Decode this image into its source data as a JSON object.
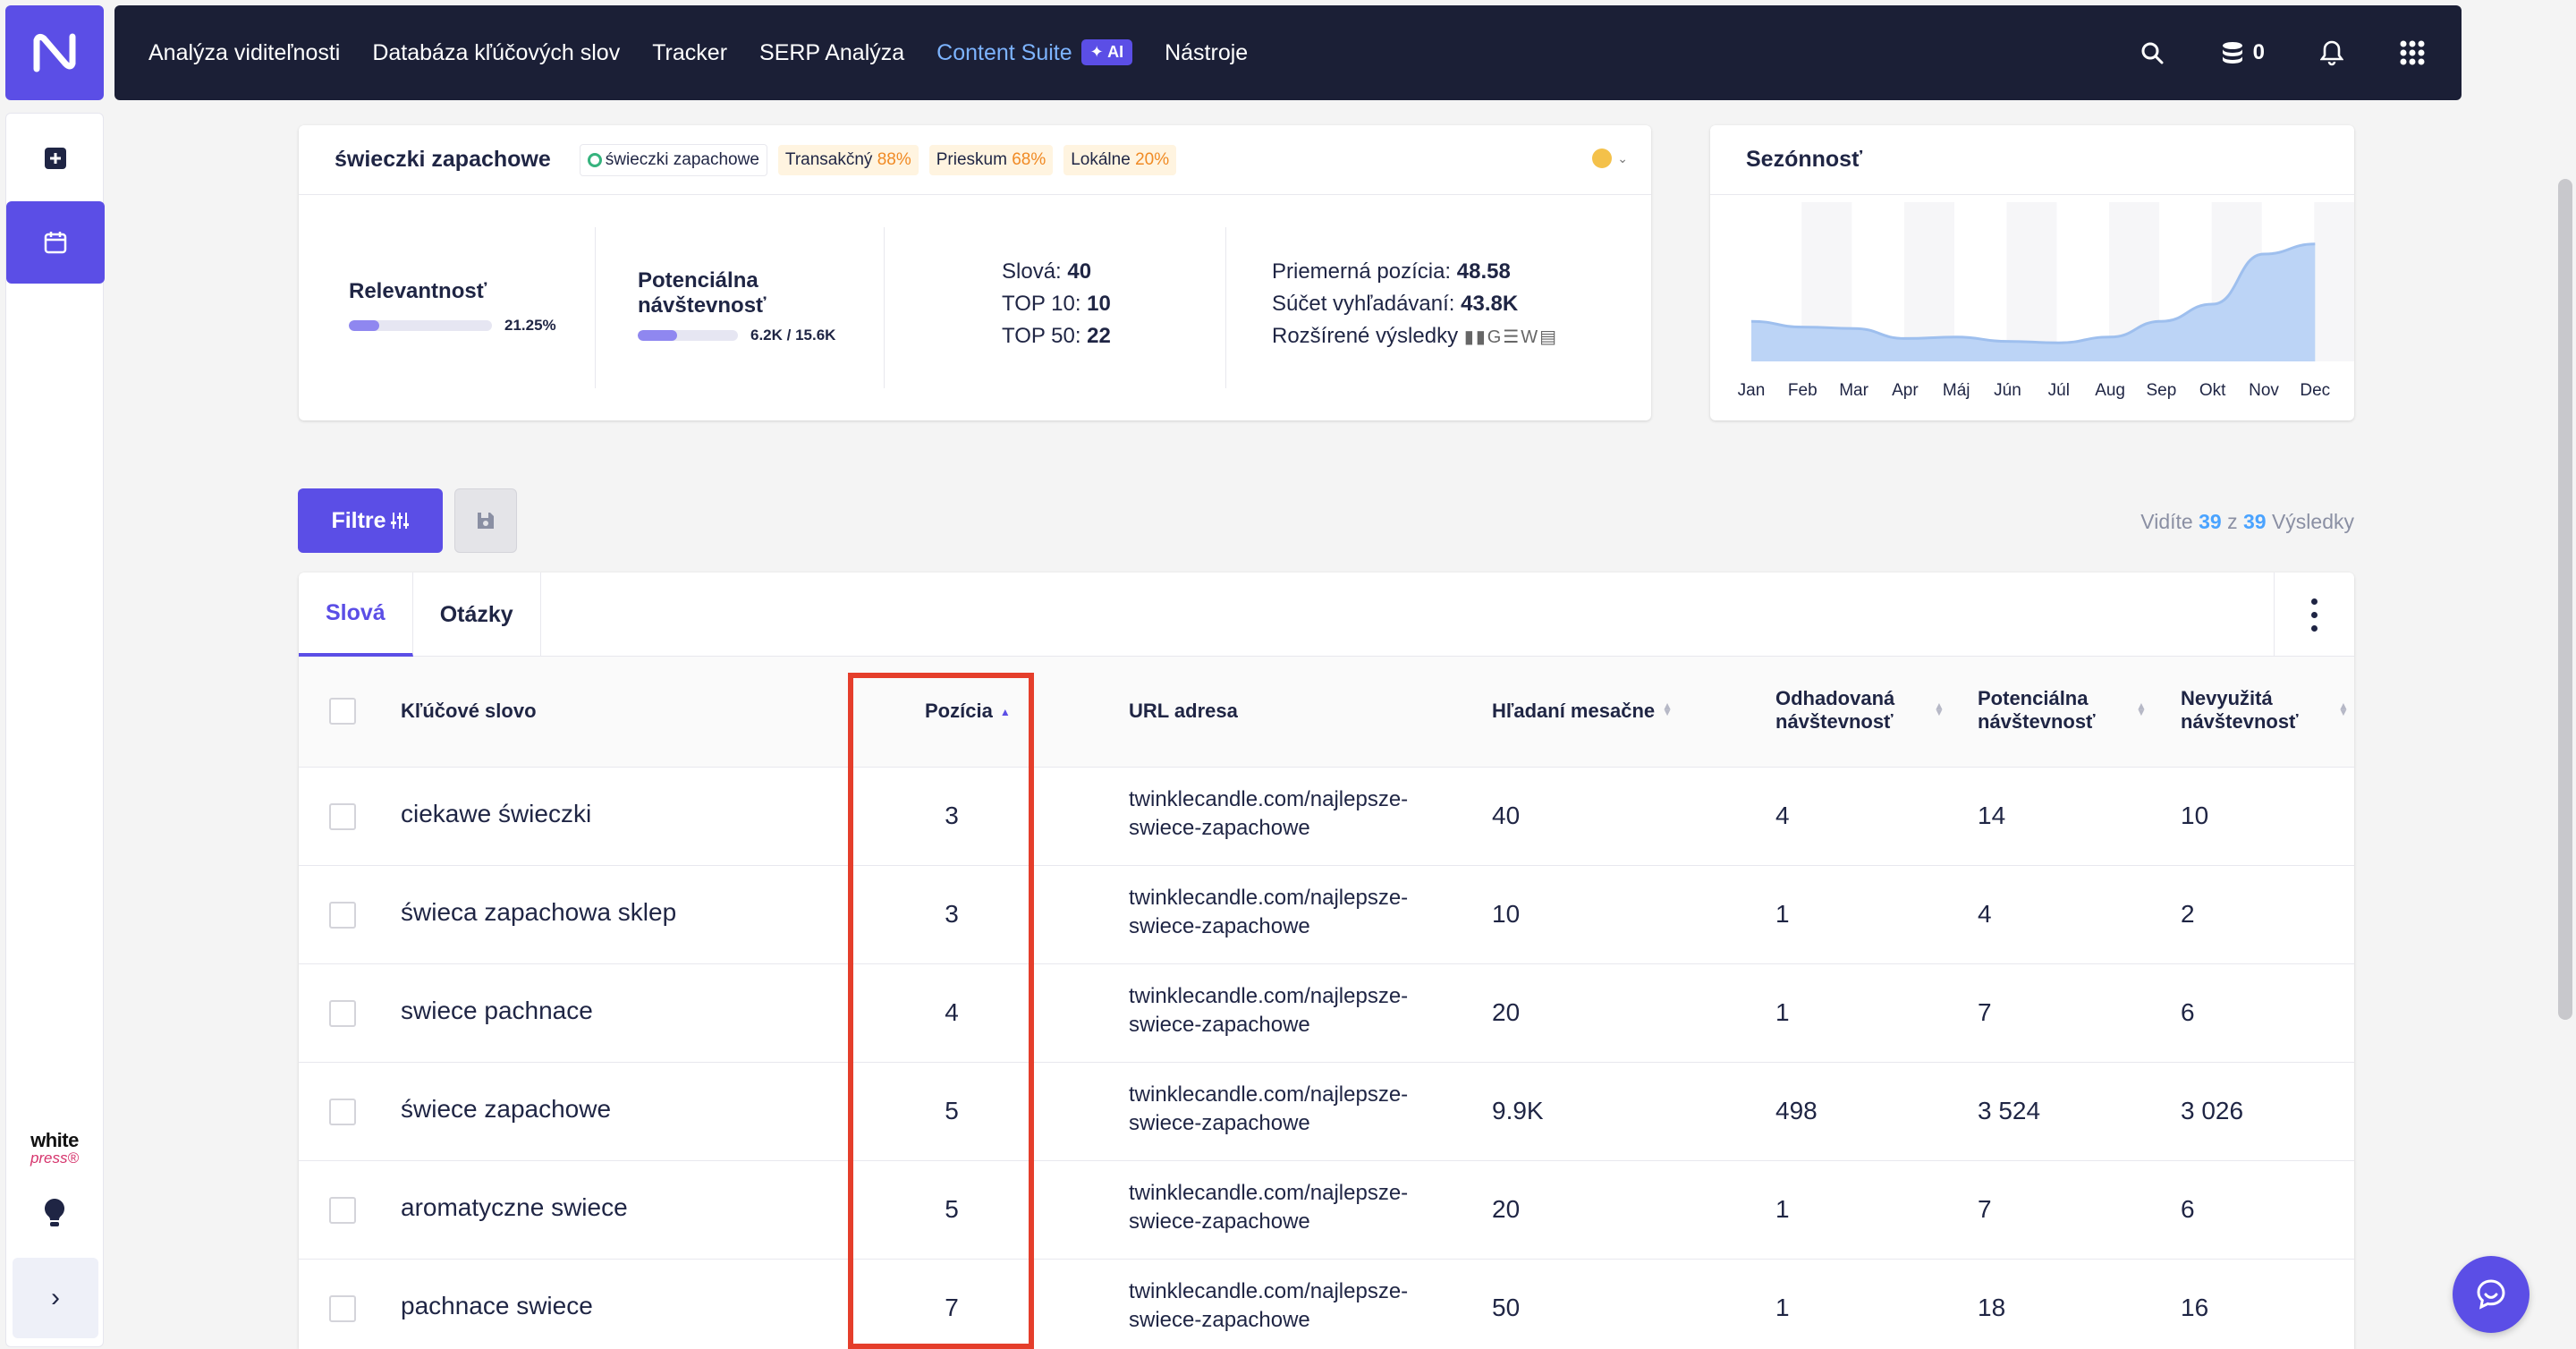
{
  "nav": {
    "items": [
      {
        "label": "Analýza viditeľnosti"
      },
      {
        "label": "Databáza kľúčových slov"
      },
      {
        "label": "Tracker"
      },
      {
        "label": "SERP Analýza"
      },
      {
        "label": "Content Suite",
        "badge": "AI"
      },
      {
        "label": "Nástroje"
      }
    ],
    "credits": "0"
  },
  "sidebar": {
    "brand_line1": "white",
    "brand_line2": "press®"
  },
  "keyword_card": {
    "title": "świeczki zapachowe",
    "chips": [
      {
        "label": "świeczki zapachowe"
      },
      {
        "label": "Transakčný",
        "pct": "88%"
      },
      {
        "label": "Prieskum",
        "pct": "68%"
      },
      {
        "label": "Lokálne",
        "pct": "20%"
      }
    ],
    "relevance": {
      "label": "Relevantnosť",
      "value": "21.25%",
      "fraction": 0.2125
    },
    "potential": {
      "label": "Potenciálna návštevnosť",
      "value": "6.2K / 15.6K",
      "fraction": 0.397
    },
    "stats_mid": [
      {
        "label": "Slová:",
        "value": "40"
      },
      {
        "label": "TOP 10:",
        "value": "10"
      },
      {
        "label": "TOP 50:",
        "value": "22"
      }
    ],
    "stats_right": [
      {
        "label": "Priemerná pozícia:",
        "value": "48.58"
      },
      {
        "label": "Súčet vyhľadávaní:",
        "value": "43.8K"
      },
      {
        "label": "Rozšírené výsledky",
        "value": ""
      }
    ]
  },
  "seasonality": {
    "title": "Sezónnosť",
    "months": [
      "Jan",
      "Feb",
      "Mar",
      "Apr",
      "Máj",
      "Jún",
      "Júl",
      "Aug",
      "Sep",
      "Okt",
      "Nov",
      "Dec"
    ]
  },
  "chart_data": {
    "type": "area",
    "categories": [
      "Jan",
      "Feb",
      "Mar",
      "Apr",
      "Máj",
      "Jún",
      "Júl",
      "Aug",
      "Sep",
      "Okt",
      "Nov",
      "Dec"
    ],
    "values": [
      0.28,
      0.24,
      0.23,
      0.16,
      0.17,
      0.14,
      0.13,
      0.17,
      0.28,
      0.4,
      0.75,
      0.82
    ],
    "title": "Sezónnosť",
    "ylim": [
      0,
      1
    ],
    "grid": false
  },
  "filters": {
    "filter_label": "Filtre",
    "results_prefix": "Vidíte",
    "results_shown": "39",
    "results_of": "z",
    "results_total": "39",
    "results_suffix": "Výsledky"
  },
  "table": {
    "tabs": [
      {
        "label": "Slová"
      },
      {
        "label": "Otázky"
      }
    ],
    "columns": {
      "keyword": "Kľúčové slovo",
      "position": "Pozícia",
      "url": "URL adresa",
      "searches": "Hľadaní mesačne",
      "est": "Odhadovaná návštevnosť",
      "pot": "Potenciálna návštevnosť",
      "unused": "Nevyužitá návštevnosť"
    },
    "rows": [
      {
        "keyword": "ciekawe świeczki",
        "position": "3",
        "url": "twinklecandle.com/najlepsze-swiece-zapachowe",
        "searches": "40",
        "est": "4",
        "pot": "14",
        "unused": "10"
      },
      {
        "keyword": "świeca zapachowa sklep",
        "position": "3",
        "url": "twinklecandle.com/najlepsze-swiece-zapachowe",
        "searches": "10",
        "est": "1",
        "pot": "4",
        "unused": "2"
      },
      {
        "keyword": "swiece pachnace",
        "position": "4",
        "url": "twinklecandle.com/najlepsze-swiece-zapachowe",
        "searches": "20",
        "est": "1",
        "pot": "7",
        "unused": "6"
      },
      {
        "keyword": "świece zapachowe",
        "position": "5",
        "url": "twinklecandle.com/najlepsze-swiece-zapachowe",
        "searches": "9.9K",
        "est": "498",
        "pot": "3 524",
        "unused": "3 026"
      },
      {
        "keyword": "aromatyczne swiece",
        "position": "5",
        "url": "twinklecandle.com/najlepsze-swiece-zapachowe",
        "searches": "20",
        "est": "1",
        "pot": "7",
        "unused": "6"
      },
      {
        "keyword": "pachnace swiece",
        "position": "7",
        "url": "twinklecandle.com/najlepsze-swiece-zapachowe",
        "searches": "50",
        "est": "1",
        "pot": "18",
        "unused": "16"
      }
    ]
  },
  "colors": {
    "accent": "#5b4ee6",
    "nav_bg": "#1b1f36",
    "highlight": "#e53e2b",
    "chart_fill": "#bcd4f6",
    "chart_line": "#9ebfee"
  }
}
